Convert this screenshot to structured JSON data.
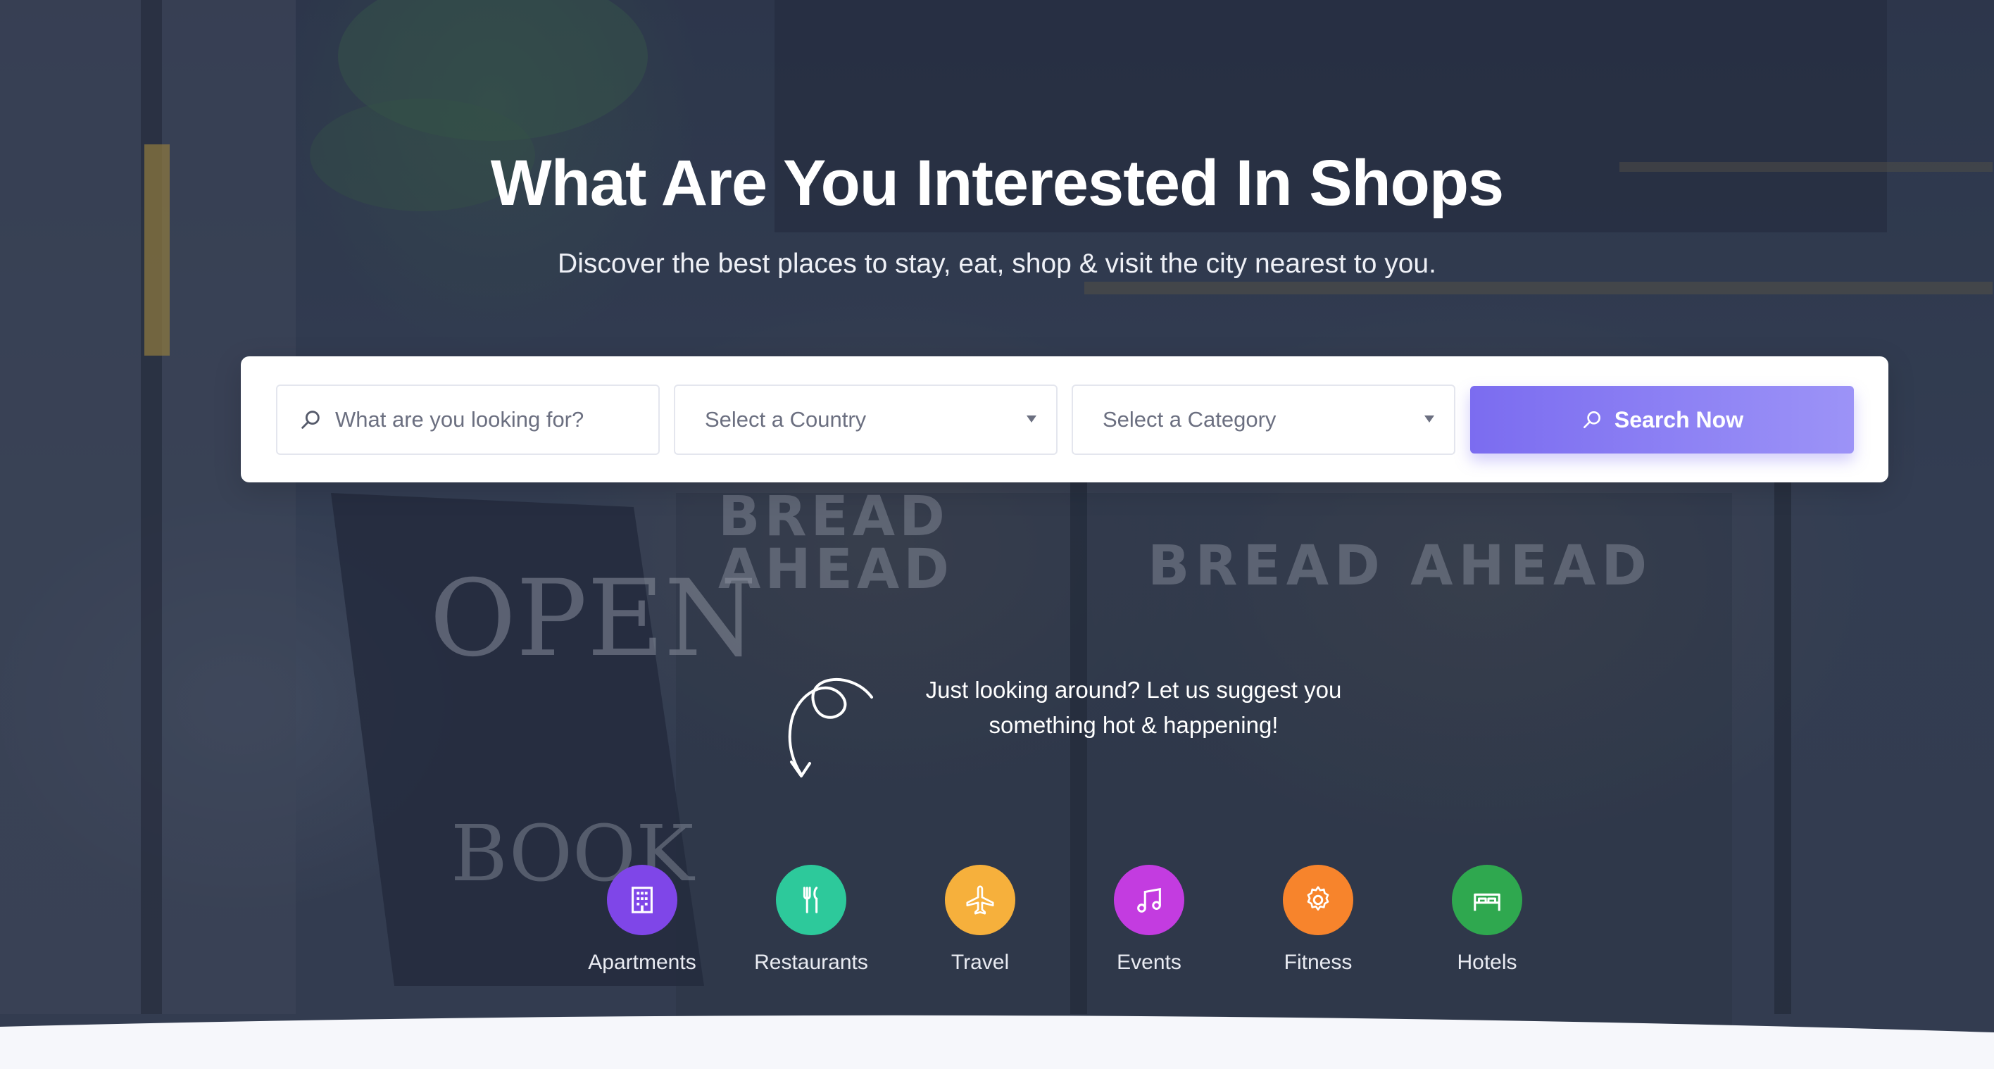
{
  "hero": {
    "title": "What Are You Interested In Shops",
    "subtitle": "Discover the best places to stay, eat, shop & visit the city nearest to you."
  },
  "search": {
    "placeholder": "What are you looking for?",
    "country_label": "Select a Country",
    "category_label": "Select a Category",
    "button_label": "Search Now"
  },
  "suggestion": {
    "line1": "Just looking around? Let us suggest you",
    "line2": "something hot & happening!"
  },
  "categories": [
    {
      "label": "Apartments",
      "icon": "building-icon",
      "color": "#7f46e8"
    },
    {
      "label": "Restaurants",
      "icon": "utensils-icon",
      "color": "#2dc99b"
    },
    {
      "label": "Travel",
      "icon": "airplane-icon",
      "color": "#f6b03c"
    },
    {
      "label": "Events",
      "icon": "music-note-icon",
      "color": "#c33ce0"
    },
    {
      "label": "Fitness",
      "icon": "gear-icon",
      "color": "#f7842c"
    },
    {
      "label": "Hotels",
      "icon": "bed-icon",
      "color": "#2fa84f"
    }
  ],
  "colors": {
    "accent": "#7b6cf0",
    "overlay": "#2f3850"
  }
}
